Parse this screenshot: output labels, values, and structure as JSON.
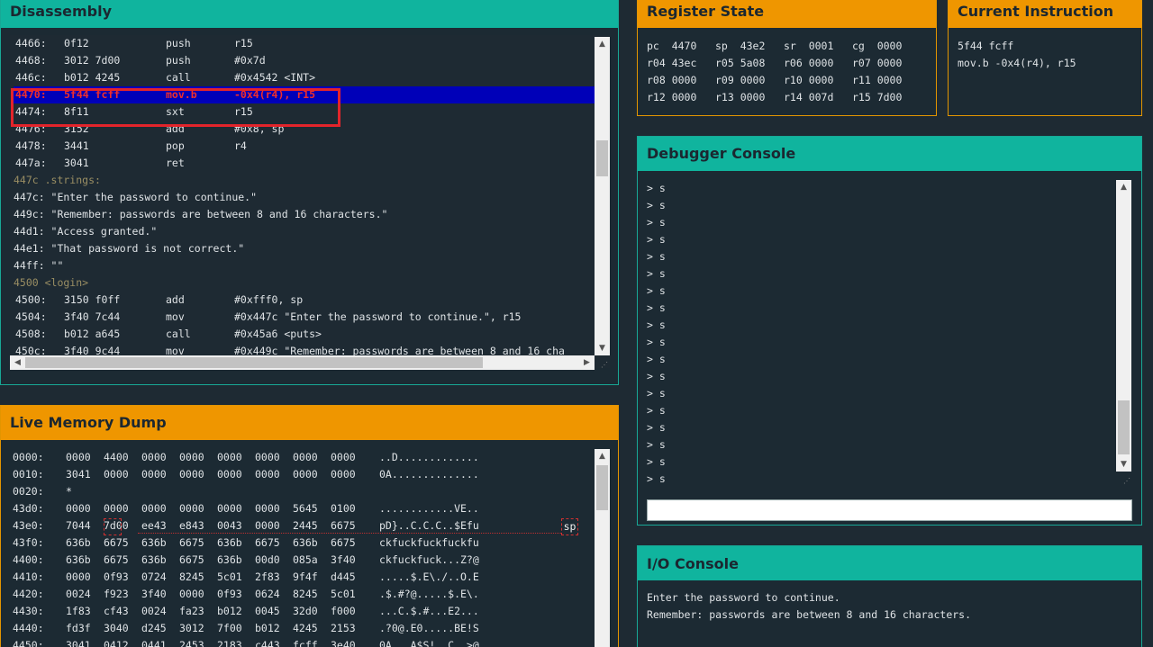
{
  "disassembly": {
    "title": "Disassembly",
    "lines": [
      {
        "addr": "4466:",
        "bytes": "0f12",
        "op": "push",
        "args": "r15"
      },
      {
        "addr": "4468:",
        "bytes": "3012 7d00",
        "op": "push",
        "args": "#0x7d"
      },
      {
        "addr": "446c:",
        "bytes": "b012 4245",
        "op": "call",
        "args": "#0x4542 <INT>"
      },
      {
        "addr": "4470:",
        "bytes": "5f44 fcff",
        "op": "mov.b",
        "args": "-0x4(r4), r15"
      },
      {
        "addr": "4474:",
        "bytes": "8f11",
        "op": "sxt",
        "args": "r15"
      },
      {
        "addr": "4476:",
        "bytes": "3152",
        "op": "add",
        "args": "#0x8, sp"
      },
      {
        "addr": "4478:",
        "bytes": "3441",
        "op": "pop",
        "args": "r4"
      },
      {
        "addr": "447a:",
        "bytes": "3041",
        "op": "ret",
        "args": ""
      },
      {
        "label": "447c .strings:"
      },
      {
        "text": "447c: \"Enter the password to continue.\""
      },
      {
        "text": "449c: \"Remember: passwords are between 8 and 16 characters.\""
      },
      {
        "text": "44d1: \"Access granted.\""
      },
      {
        "text": "44e1: \"That password is not correct.\""
      },
      {
        "text": "44ff: \"\""
      },
      {
        "label": "4500 <login>"
      },
      {
        "addr": "4500:",
        "bytes": "3150 f0ff",
        "op": "add",
        "args": "#0xfff0, sp"
      },
      {
        "addr": "4504:",
        "bytes": "3f40 7c44",
        "op": "mov",
        "args": "#0x447c \"Enter the password to continue.\", r15"
      },
      {
        "addr": "4508:",
        "bytes": "b012 a645",
        "op": "call",
        "args": "#0x45a6 <puts>"
      },
      {
        "addr": "450c:",
        "bytes": "3f40 9c44",
        "op": "mov",
        "args": "#0x449c \"Remember: passwords are between 8 and 16 cha"
      }
    ]
  },
  "registers": {
    "title": "Register State",
    "rows": [
      [
        [
          "pc",
          "4470"
        ],
        [
          "sp",
          "43e2"
        ],
        [
          "sr",
          "0001"
        ],
        [
          "cg",
          "0000"
        ]
      ],
      [
        [
          "r04",
          "43ec"
        ],
        [
          "r05",
          "5a08"
        ],
        [
          "r06",
          "0000"
        ],
        [
          "r07",
          "0000"
        ]
      ],
      [
        [
          "r08",
          "0000"
        ],
        [
          "r09",
          "0000"
        ],
        [
          "r10",
          "0000"
        ],
        [
          "r11",
          "0000"
        ]
      ],
      [
        [
          "r12",
          "0000"
        ],
        [
          "r13",
          "0000"
        ],
        [
          "r14",
          "007d"
        ],
        [
          "r15",
          "7d00"
        ]
      ]
    ]
  },
  "current_instruction": {
    "title": "Current Instruction",
    "bytes": "5f44 fcff",
    "text": "mov.b -0x4(r4), r15"
  },
  "debugger": {
    "title": "Debugger Console",
    "lines": [
      "> s",
      "> s",
      "> s",
      "> s",
      "> s",
      "> s",
      "> s",
      "> s",
      "> s",
      "> s",
      "> s",
      "> s",
      "> s",
      "> s",
      "> s",
      "> s",
      "> s",
      "> s"
    ],
    "input_value": ""
  },
  "memory": {
    "title": "Live Memory Dump",
    "sp_label": "sp",
    "rows": [
      {
        "addr": "0000:",
        "words": [
          "0000",
          "4400",
          "0000",
          "0000",
          "0000",
          "0000",
          "0000",
          "0000"
        ],
        "ascii": "..D............."
      },
      {
        "addr": "0010:",
        "words": [
          "3041",
          "0000",
          "0000",
          "0000",
          "0000",
          "0000",
          "0000",
          "0000"
        ],
        "ascii": "0A.............."
      },
      {
        "addr": "0020:",
        "words": [
          "*"
        ],
        "ascii": ""
      },
      {
        "addr": "43d0:",
        "words": [
          "0000",
          "0000",
          "0000",
          "0000",
          "0000",
          "0000",
          "5645",
          "0100"
        ],
        "ascii": "............VE.."
      },
      {
        "addr": "43e0:",
        "words": [
          "7044",
          "7d00",
          "ee43",
          "e843",
          "0043",
          "0000",
          "2445",
          "6675"
        ],
        "ascii": "pD}..C.C.C..$Efu"
      },
      {
        "addr": "43f0:",
        "words": [
          "636b",
          "6675",
          "636b",
          "6675",
          "636b",
          "6675",
          "636b",
          "6675"
        ],
        "ascii": "ckfuckfuckfuckfu"
      },
      {
        "addr": "4400:",
        "words": [
          "636b",
          "6675",
          "636b",
          "6675",
          "636b",
          "00d0",
          "085a",
          "3f40"
        ],
        "ascii": "ckfuckfuck...Z?@"
      },
      {
        "addr": "4410:",
        "words": [
          "0000",
          "0f93",
          "0724",
          "8245",
          "5c01",
          "2f83",
          "9f4f",
          "d445"
        ],
        "ascii": ".....$.E\\./..O.E"
      },
      {
        "addr": "4420:",
        "words": [
          "0024",
          "f923",
          "3f40",
          "0000",
          "0f93",
          "0624",
          "8245",
          "5c01"
        ],
        "ascii": ".$.#?@.....$.E\\."
      },
      {
        "addr": "4430:",
        "words": [
          "1f83",
          "cf43",
          "0024",
          "fa23",
          "b012",
          "0045",
          "32d0",
          "f000"
        ],
        "ascii": "...C.$.#...E2..."
      },
      {
        "addr": "4440:",
        "words": [
          "fd3f",
          "3040",
          "d245",
          "3012",
          "7f00",
          "b012",
          "4245",
          "2153"
        ],
        "ascii": ".?0@.E0.....BE!S"
      },
      {
        "addr": "4450:",
        "words": [
          "3041",
          "0412",
          "0441",
          "2453",
          "2183",
          "c443",
          "fcff",
          "3e40"
        ],
        "ascii": "0A...A$S!..C..>@"
      }
    ]
  },
  "io": {
    "title": "I/O Console",
    "lines": [
      "Enter the password to continue.",
      "Remember: passwords are between 8 and 16 characters."
    ]
  }
}
